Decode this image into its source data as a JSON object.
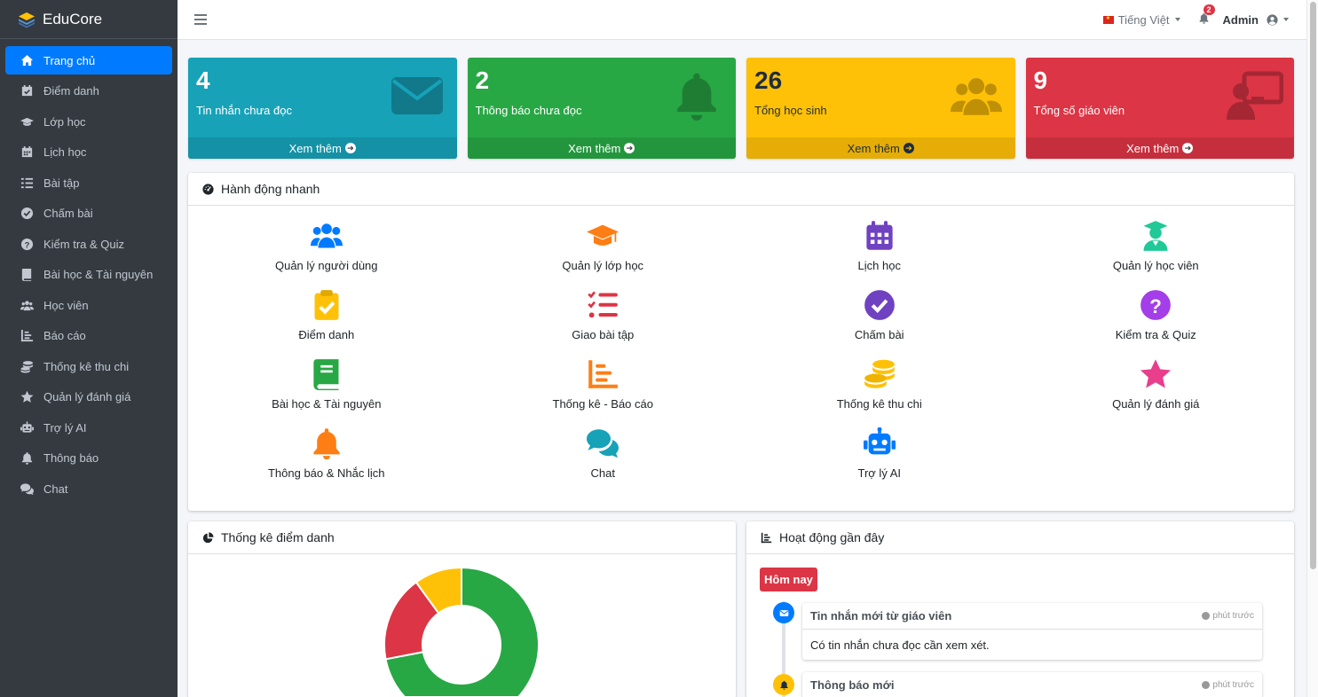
{
  "brand": {
    "name": "EduCore"
  },
  "sidebar": {
    "items": [
      {
        "label": "Trang chủ",
        "icon": "home-icon",
        "active": true
      },
      {
        "label": "Điểm danh",
        "icon": "calendar-check-icon"
      },
      {
        "label": "Lớp học",
        "icon": "graduation-cap-icon"
      },
      {
        "label": "Lịch học",
        "icon": "calendar-icon"
      },
      {
        "label": "Bài tập",
        "icon": "list-check-icon"
      },
      {
        "label": "Chấm bài",
        "icon": "check-circle-icon"
      },
      {
        "label": "Kiểm tra & Quiz",
        "icon": "question-circle-icon"
      },
      {
        "label": "Bài học & Tài nguyên",
        "icon": "book-icon"
      },
      {
        "label": "Học viên",
        "icon": "users-icon"
      },
      {
        "label": "Báo cáo",
        "icon": "chart-icon"
      },
      {
        "label": "Thống kê thu chi",
        "icon": "coins-icon"
      },
      {
        "label": "Quản lý đánh giá",
        "icon": "star-icon"
      },
      {
        "label": "Trợ lý AI",
        "icon": "robot-icon"
      },
      {
        "label": "Thông báo",
        "icon": "bell-icon"
      },
      {
        "label": "Chat",
        "icon": "comments-icon"
      }
    ]
  },
  "topbar": {
    "language": "Tiếng Việt",
    "notification_count": "2",
    "user": "Admin"
  },
  "stats": [
    {
      "value": "4",
      "label": "Tin nhắn chưa đọc",
      "more": "Xem thêm",
      "icon": "envelope-icon",
      "color": "#17a2b8"
    },
    {
      "value": "2",
      "label": "Thông báo chưa đọc",
      "more": "Xem thêm",
      "icon": "bell-icon",
      "color": "#28a745"
    },
    {
      "value": "26",
      "label": "Tổng học sinh",
      "more": "Xem thêm",
      "icon": "users-icon",
      "color": "#ffc107"
    },
    {
      "value": "9",
      "label": "Tổng số giáo viên",
      "more": "Xem thêm",
      "icon": "teacher-icon",
      "color": "#dc3545"
    }
  ],
  "quick_actions": {
    "title": "Hành động nhanh",
    "items": [
      {
        "label": "Quản lý người dùng",
        "icon": "users-icon",
        "color": "#007bff"
      },
      {
        "label": "Quản lý lớp học",
        "icon": "graduation-cap-icon",
        "color": "#fd7e14"
      },
      {
        "label": "Lịch học",
        "icon": "calendar-icon",
        "color": "#6f42c1"
      },
      {
        "label": "Quản lý học viên",
        "icon": "user-graduate-icon",
        "color": "#20c997"
      },
      {
        "label": "Điểm danh",
        "icon": "clipboard-check-icon",
        "color": "#ffc107"
      },
      {
        "label": "Giao bài tập",
        "icon": "list-check-icon",
        "color": "#dc3545"
      },
      {
        "label": "Chấm bài",
        "icon": "check-circle-icon",
        "color": "#6f42c1"
      },
      {
        "label": "Kiểm tra & Quiz",
        "icon": "question-circle-icon",
        "color": "#a33ee8"
      },
      {
        "label": "Bài học & Tài nguyên",
        "icon": "book-icon",
        "color": "#28a745"
      },
      {
        "label": "Thống kê - Báo cáo",
        "icon": "chart-icon",
        "color": "#fd7e14"
      },
      {
        "label": "Thống kê thu chi",
        "icon": "coins-icon",
        "color": "#ffc107"
      },
      {
        "label": "Quản lý đánh giá",
        "icon": "star-icon",
        "color": "#e83e8c"
      },
      {
        "label": "Thông báo & Nhắc lịch",
        "icon": "bell-icon",
        "color": "#fd7e14"
      },
      {
        "label": "Chat",
        "icon": "comments-icon",
        "color": "#17a2b8"
      },
      {
        "label": "Trợ lý AI",
        "icon": "robot-icon",
        "color": "#007bff"
      }
    ]
  },
  "attendance": {
    "title": "Thống kê điểm danh"
  },
  "chart_data": {
    "type": "pie",
    "variant": "donut",
    "slices": [
      {
        "color": "#28a745",
        "value": 0.72
      },
      {
        "color": "#dc3545",
        "value": 0.18
      },
      {
        "color": "#ffc107",
        "value": 0.1
      }
    ]
  },
  "activity": {
    "title": "Hoạt động gần đây",
    "today_label": "Hôm nay",
    "items": [
      {
        "title": "Tin nhắn mới từ giáo viên",
        "time": "phút trước",
        "body": "Có tin nhắn chưa đọc cần xem xét.",
        "icon": "envelope-icon",
        "color": "#007bff"
      },
      {
        "title": "Thông báo mới",
        "time": "phút trước",
        "body": "",
        "icon": "bell-icon",
        "color": "#ffc107"
      }
    ]
  }
}
